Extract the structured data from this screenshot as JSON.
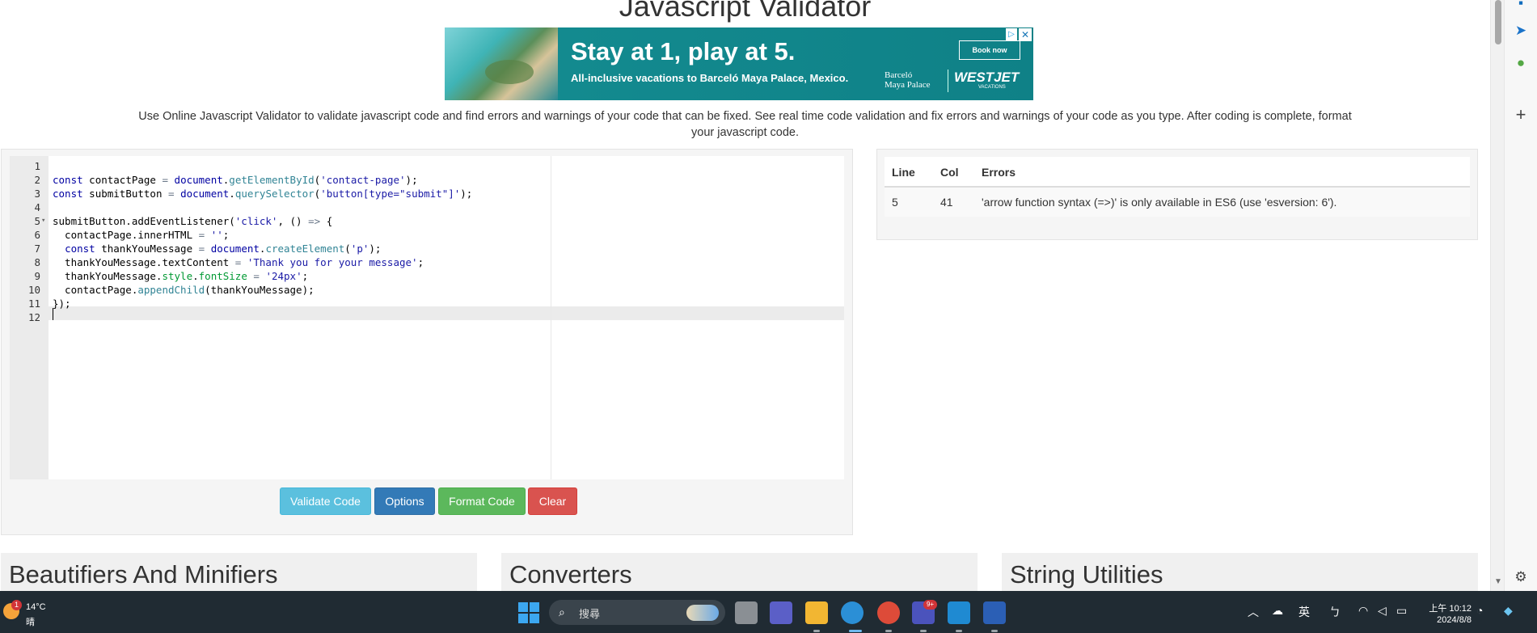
{
  "page": {
    "title": "Javascript Validator",
    "description": "Use Online Javascript Validator to validate javascript code and find errors and warnings of your code that can be fixed. See real time code validation and fix errors and warnings of your code as you type. After coding is complete, format your javascript code."
  },
  "ad": {
    "headline": "Stay at 1, play at 5.",
    "subline": "All-inclusive vacations to Barceló Maya Palace, Mexico.",
    "book_label": "Book now",
    "brand_barcelo": "Barceló",
    "brand_barcelo_sub": "Maya Palace",
    "brand_westjet": "WESTJET",
    "brand_westjet_sub": "VACATIONS",
    "info_icon": "info-triangle-icon",
    "close_icon": "close-icon"
  },
  "editor": {
    "line_numbers": [
      "1",
      "2",
      "3",
      "4",
      "5",
      "6",
      "7",
      "8",
      "9",
      "10",
      "11",
      "12"
    ],
    "lines": [
      "",
      "const contactPage = document.getElementById('contact-page');",
      "const submitButton = document.querySelector('button[type=\"submit\"]');",
      "",
      "submitButton.addEventListener('click', () => {",
      "  contactPage.innerHTML = '';",
      "  const thankYouMessage = document.createElement('p');",
      "  thankYouMessage.textContent = 'Thank you for your message';",
      "  thankYouMessage.style.fontSize = '24px';",
      "  contactPage.appendChild(thankYouMessage);",
      "});",
      ""
    ]
  },
  "buttons": {
    "validate": "Validate Code",
    "options": "Options",
    "format": "Format Code",
    "clear": "Clear"
  },
  "errors": {
    "headers": {
      "line": "Line",
      "col": "Col",
      "errors": "Errors"
    },
    "rows": [
      {
        "line": "5",
        "col": "41",
        "message": "'arrow function syntax (=>)' is only available in ES6 (use 'esversion: 6')."
      }
    ]
  },
  "categories": [
    "Beautifiers And Minifiers",
    "Converters",
    "String Utilities"
  ],
  "taskbar": {
    "temperature": "14°C",
    "condition": "晴",
    "weather_badge": "1",
    "search_placeholder": "搜尋",
    "teams_badge": "9+",
    "ime": "英",
    "ime_mode": "ㄅ",
    "time": "上午 10:12",
    "date": "2024/8/8"
  },
  "colors": {
    "validate": "#5bc0de",
    "options": "#337ab7",
    "format": "#5cb85c",
    "clear": "#d9534f",
    "taskbar": "#202b33"
  }
}
